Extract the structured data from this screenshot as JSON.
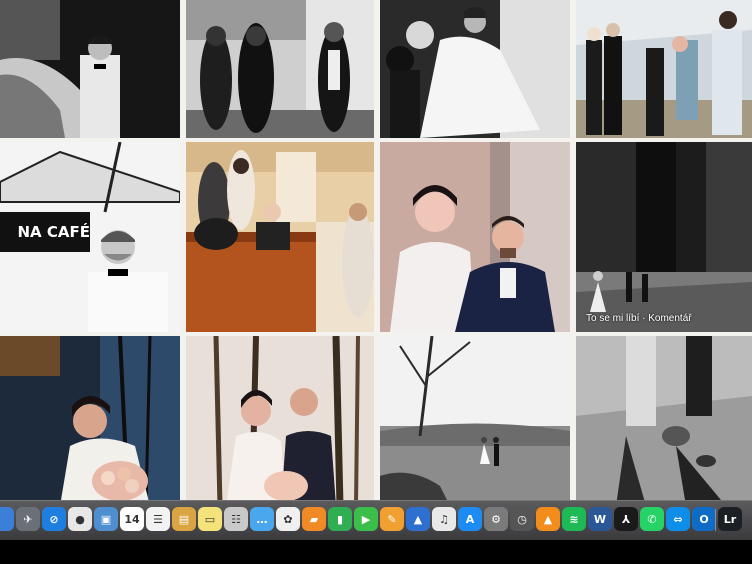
{
  "overlay": {
    "photo_actions": "To se mi líbí · Komentář"
  },
  "photos": [
    {
      "row": 1,
      "col": 1,
      "name": "photo-groom-bowtie-car",
      "tone": "bw"
    },
    {
      "row": 1,
      "col": 2,
      "name": "photo-group-church-steps",
      "tone": "bw"
    },
    {
      "row": 1,
      "col": 3,
      "name": "photo-bride-dancing-bouquet",
      "tone": "bw"
    },
    {
      "row": 1,
      "col": 4,
      "name": "photo-guests-walking-park",
      "tone": "color"
    },
    {
      "row": 2,
      "col": 1,
      "name": "photo-cafe-tent-man",
      "tone": "bw"
    },
    {
      "row": 2,
      "col": 2,
      "name": "photo-guests-church-pews",
      "tone": "color"
    },
    {
      "row": 2,
      "col": 3,
      "name": "photo-bride-groom-smiling",
      "tone": "color"
    },
    {
      "row": 2,
      "col": 4,
      "name": "photo-castle-tower-bride",
      "tone": "bw"
    },
    {
      "row": 3,
      "col": 1,
      "name": "photo-bride-bouquet-trees",
      "tone": "color"
    },
    {
      "row": 3,
      "col": 2,
      "name": "photo-couple-forest",
      "tone": "color"
    },
    {
      "row": 3,
      "col": 3,
      "name": "photo-couple-meadow",
      "tone": "bw"
    },
    {
      "row": 3,
      "col": 4,
      "name": "photo-shadows-ground",
      "tone": "bw"
    }
  ],
  "cafe_sign": "NA CAFÉ",
  "dock": {
    "icons": [
      {
        "name": "finder-partial-icon",
        "label": "",
        "bg": "#3b7fd9"
      },
      {
        "name": "launchpad-icon",
        "label": "✈",
        "bg": "#6b6f78"
      },
      {
        "name": "safari-icon",
        "label": "⊘",
        "bg": "#1f7fe0"
      },
      {
        "name": "chrome-icon",
        "label": "●",
        "bg": "#e8e8e8"
      },
      {
        "name": "preview-icon",
        "label": "▣",
        "bg": "#4f8fd0"
      },
      {
        "name": "calendar-icon",
        "label": "14",
        "bg": "#ffffff"
      },
      {
        "name": "reminders-icon",
        "label": "☰",
        "bg": "#f2f2f2"
      },
      {
        "name": "notes-icon",
        "label": "▤",
        "bg": "#d9a441"
      },
      {
        "name": "stickies-icon",
        "label": "▭",
        "bg": "#f4e27a"
      },
      {
        "name": "contacts-icon",
        "label": "☷",
        "bg": "#c9c9c9"
      },
      {
        "name": "messages-icon",
        "label": "…",
        "bg": "#4aa7ee"
      },
      {
        "name": "photos-icon",
        "label": "✿",
        "bg": "#f0f0f0"
      },
      {
        "name": "ibooks-icon",
        "label": "▰",
        "bg": "#f08a24"
      },
      {
        "name": "numbers-icon",
        "label": "▮",
        "bg": "#2fae52"
      },
      {
        "name": "facetime-icon",
        "label": "▶",
        "bg": "#3cbf4a"
      },
      {
        "name": "pages-icon",
        "label": "✎",
        "bg": "#f0a030"
      },
      {
        "name": "keynote-icon",
        "label": "▲",
        "bg": "#2f6fd0"
      },
      {
        "name": "itunes-icon",
        "label": "♫",
        "bg": "#e9e9e9"
      },
      {
        "name": "app-store-icon",
        "label": "A",
        "bg": "#1d8bf0"
      },
      {
        "name": "system-preferences-icon",
        "label": "⚙",
        "bg": "#7a7a7a"
      },
      {
        "name": "time-machine-icon",
        "label": "◷",
        "bg": "#555555"
      },
      {
        "name": "vlc-icon",
        "label": "▲",
        "bg": "#f28c1b"
      },
      {
        "name": "spotify-icon",
        "label": "≋",
        "bg": "#1db954"
      },
      {
        "name": "word-icon",
        "label": "W",
        "bg": "#2b5797"
      },
      {
        "name": "adobe-acrobat-icon",
        "label": "⅄",
        "bg": "#1a1a1a"
      },
      {
        "name": "whatsapp-icon",
        "label": "✆",
        "bg": "#25d366"
      },
      {
        "name": "teamviewer-icon",
        "label": "⇔",
        "bg": "#0e8ee9"
      },
      {
        "name": "outlook-icon",
        "label": "O",
        "bg": "#0f6cc6"
      },
      {
        "name": "lightroom-icon",
        "label": "Lr",
        "bg": "#1c1f24"
      }
    ]
  }
}
